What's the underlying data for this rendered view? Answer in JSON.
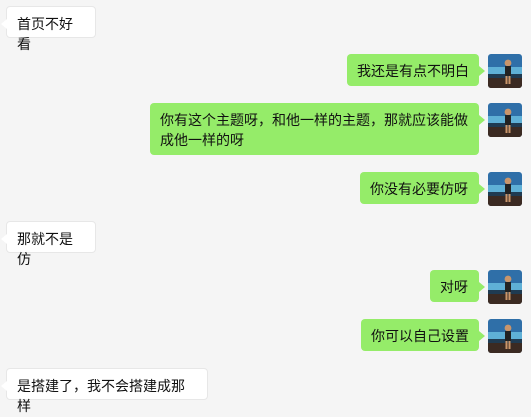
{
  "conversation": {
    "messages": [
      {
        "side": "in",
        "text": "首页不好看"
      },
      {
        "side": "out",
        "text": "我还是有点不明白"
      },
      {
        "side": "out",
        "text": "你有这个主题呀，和他一样的主题，那就应该能做成他一样的呀"
      },
      {
        "side": "out",
        "text": "你没有必要仿呀"
      },
      {
        "side": "in",
        "text": "那就不是仿"
      },
      {
        "side": "out",
        "text": "对呀"
      },
      {
        "side": "out",
        "text": "你可以自己设置"
      },
      {
        "side": "in",
        "text": "是搭建了，我不会搭建成那样"
      }
    ]
  },
  "avatar": {
    "icon": "user-avatar-beach-photo"
  },
  "colors": {
    "background": "#f5f5f5",
    "incoming_bubble": "#ffffff",
    "outgoing_bubble": "#95ec69"
  }
}
